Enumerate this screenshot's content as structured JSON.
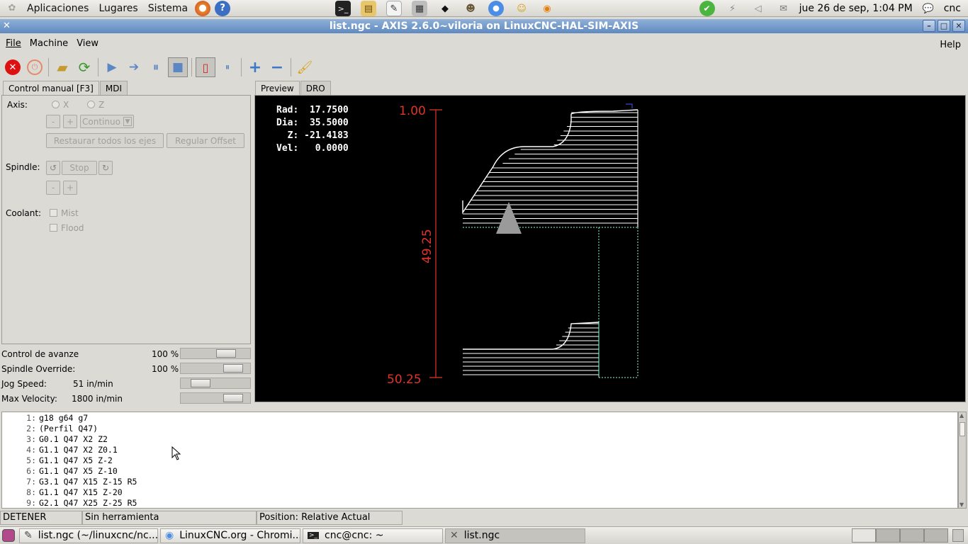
{
  "top_panel": {
    "menus": [
      "Aplicaciones",
      "Lugares",
      "Sistema"
    ],
    "clock": "jue 26 de sep,  1:04 PM",
    "user": "cnc",
    "launcher_icons": [
      "terminal-icon",
      "file-manager-icon",
      "text-editor-icon",
      "calculator-icon",
      "inkscape-icon",
      "gimp-icon",
      "chromium-icon",
      "game-icon",
      "blender-icon"
    ]
  },
  "window": {
    "title": "list.ngc - AXIS 2.6.0~viloria on LinuxCNC-HAL-SIM-AXIS"
  },
  "menubar": {
    "file": "File",
    "machine": "Machine",
    "view": "View",
    "help": "Help"
  },
  "left_tabs": [
    "Control manual [F3]",
    "MDI"
  ],
  "right_tabs": [
    "Preview",
    "DRO"
  ],
  "manual": {
    "axis_label": "Axis:",
    "axis_x": "X",
    "axis_z": "Z",
    "minus": "-",
    "plus": "+",
    "jog_mode": "Continuo",
    "home_all": "Restaurar todos los ejes",
    "touch_off": "Regular Offset",
    "spindle_label": "Spindle:",
    "spindle_stop": "Stop",
    "coolant_label": "Coolant:",
    "mist": "Mist",
    "flood": "Flood"
  },
  "sliders": {
    "feed_label": "Control de avanze",
    "feed_value": "100 %",
    "spindle_label": "Spindle Override:",
    "spindle_value": "100 %",
    "jog_label": "Jog Speed:",
    "jog_value": "51 in/min",
    "maxvel_label": "Max Velocity:",
    "maxvel_value": "1800 in/min",
    "feed_level": 0.72,
    "spindle_level": 0.85,
    "jog_level": 0.2,
    "maxvel_level": 0.85
  },
  "dro": {
    "rad_label": "Rad:",
    "rad": "17.7500",
    "dia_label": "Dia:",
    "dia": "35.5000",
    "z_label": "Z:",
    "z": "-21.4183",
    "vel_label": "Vel:",
    "vel": "0.0000"
  },
  "preview": {
    "dim_top": "1.00",
    "dim_mid": "49.25",
    "dim_bottom": "50.25"
  },
  "gcode": [
    {
      "n": "1:",
      "code": "g18 g64 g7"
    },
    {
      "n": "2:",
      "code": "(Perfil Q47)"
    },
    {
      "n": "3:",
      "code": "G0.1 Q47 X2 Z2"
    },
    {
      "n": "4:",
      "code": "G1.1 Q47 X2 Z0.1"
    },
    {
      "n": "5:",
      "code": "G1.1 Q47 X5 Z-2"
    },
    {
      "n": "6:",
      "code": "G1.1 Q47 X5 Z-10"
    },
    {
      "n": "7:",
      "code": "G3.1 Q47 X15 Z-15 R5"
    },
    {
      "n": "8:",
      "code": "G1.1 Q47 X15 Z-20"
    },
    {
      "n": "9:",
      "code": "G2.1 Q47 X25 Z-25 R5"
    }
  ],
  "status": {
    "state": "DETENER",
    "tool": "Sin herramienta",
    "position": "Position: Relative Actual"
  },
  "taskbar": {
    "tasks": [
      "list.ngc (~/linuxcnc/nc...",
      "LinuxCNC.org - Chromi...",
      "cnc@cnc: ~",
      "list.ngc"
    ]
  }
}
